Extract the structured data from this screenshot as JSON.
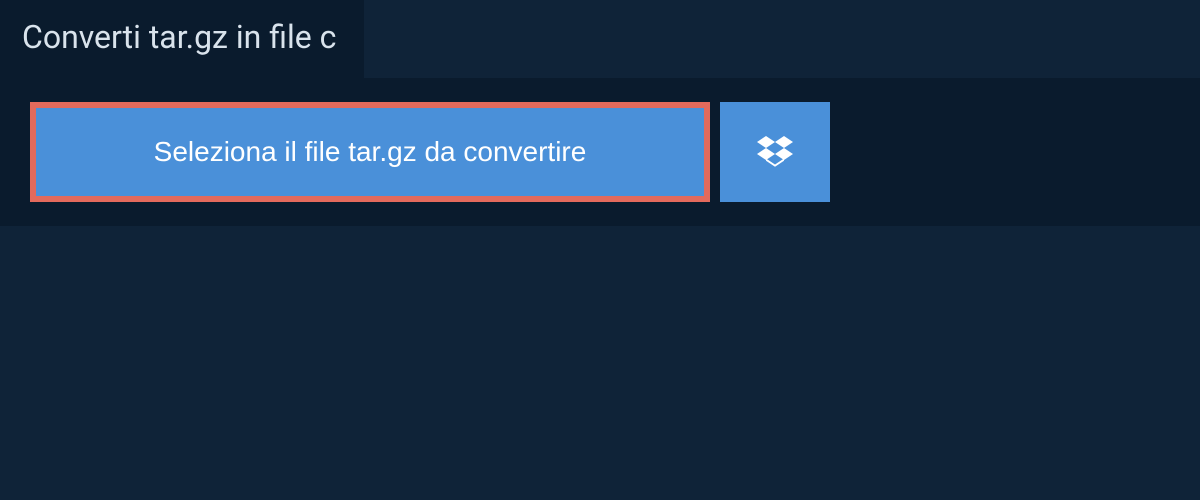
{
  "header": {
    "title": "Converti tar.gz in file c"
  },
  "main": {
    "select_file_label": "Seleziona il file tar.gz da convertire"
  },
  "colors": {
    "background_dark": "#0f2338",
    "panel_dark": "#0a1b2d",
    "button_blue": "#4a90d9",
    "highlight_border": "#e36a5c",
    "text_light": "#d9e3ec"
  }
}
